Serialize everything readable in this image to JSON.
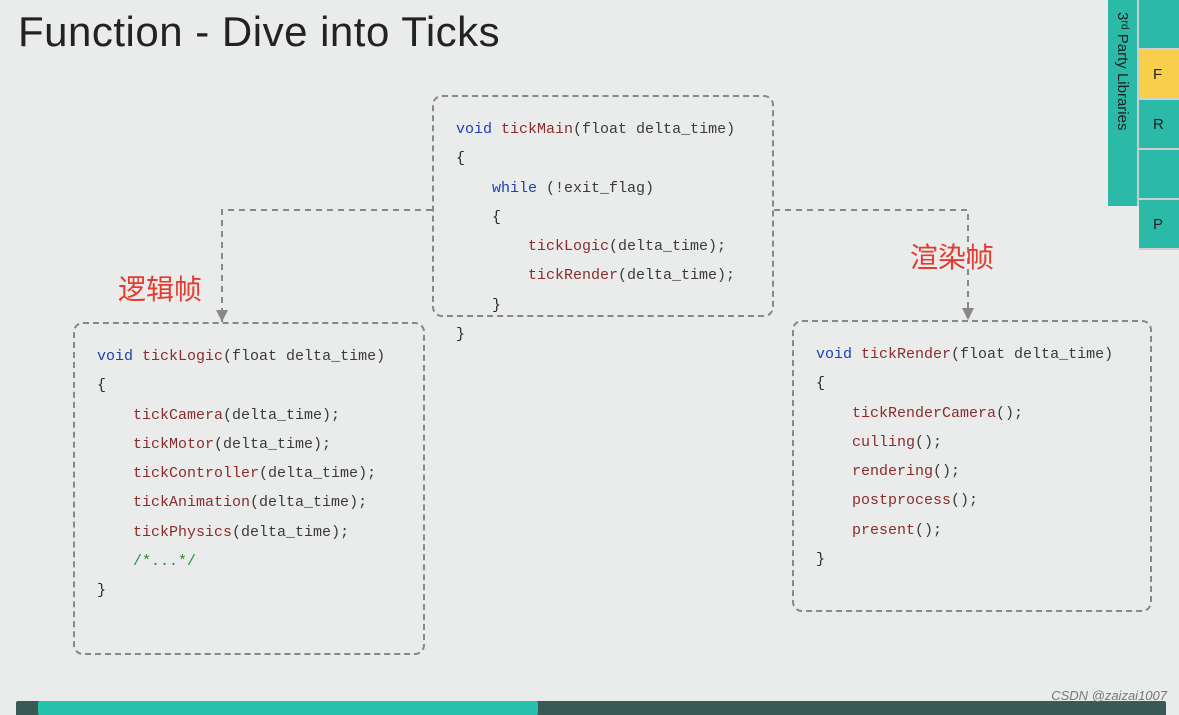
{
  "title": "Function - Dive into Ticks",
  "labels": {
    "logic": "逻辑帧",
    "render": "渲染帧"
  },
  "code": {
    "main": {
      "sig_kw": "void",
      "sig_fn": "tickMain",
      "sig_params": "(float delta_time)",
      "while_kw": "while",
      "while_cond": " (!exit_flag)",
      "call1_fn": "tickLogic",
      "call1_arg": "(delta_time);",
      "call2_fn": "tickRender",
      "call2_arg": "(delta_time);"
    },
    "logic": {
      "sig_kw": "void",
      "sig_fn": "tickLogic",
      "sig_params": "(float delta_time)",
      "calls": [
        {
          "fn": "tickCamera",
          "arg": "(delta_time);"
        },
        {
          "fn": "tickMotor",
          "arg": "(delta_time);"
        },
        {
          "fn": "tickController",
          "arg": "(delta_time);"
        },
        {
          "fn": "tickAnimation",
          "arg": "(delta_time);"
        },
        {
          "fn": "tickPhysics",
          "arg": "(delta_time);"
        }
      ],
      "comment": "/*...*/"
    },
    "render": {
      "sig_kw": "void",
      "sig_fn": "tickRender",
      "sig_params": "(float delta_time)",
      "calls": [
        {
          "fn": "tickRenderCamera",
          "arg": "();"
        },
        {
          "fn": "culling",
          "arg": "();"
        },
        {
          "fn": "rendering",
          "arg": "();"
        },
        {
          "fn": "postprocess",
          "arg": "();"
        },
        {
          "fn": "present",
          "arg": "();"
        }
      ]
    }
  },
  "sidebar": {
    "vertical": "3ʳᵈ Party Libraries",
    "items": [
      "",
      "F",
      "R",
      "",
      "P"
    ],
    "highlight_index": 1
  },
  "watermark": "CSDN @zaizai1007"
}
